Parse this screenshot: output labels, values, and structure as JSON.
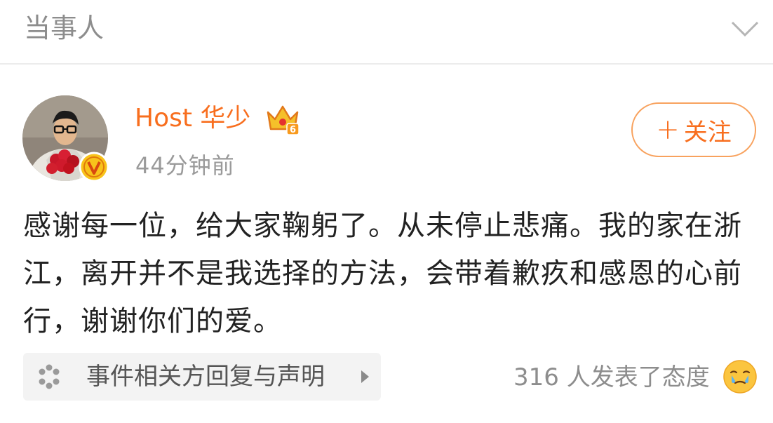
{
  "section": {
    "title": "当事人",
    "collapse_icon": "chevron-down-icon"
  },
  "author": {
    "name": "Host 华少",
    "badge_icon": "crown-level-icon",
    "crown_level": "6",
    "verified_icon": "verified-v-icon",
    "time": "44分钟前"
  },
  "follow": {
    "plus": "+",
    "label": "关注"
  },
  "post": {
    "text": "感谢每一位，给大家鞠躬了。从未停止悲痛。我的家在浙江，离开并不是我选择的方法，会带着歉疚和感恩的心前行，谢谢你们的爱。"
  },
  "topic": {
    "icon": "spinner-icon",
    "label": "事件相关方回复与声明",
    "arrow_icon": "triangle-right-icon"
  },
  "reactions": {
    "text": "316 人发表了态度",
    "emoji": "crying-face-icon"
  },
  "colors": {
    "accent": "#f86e1e",
    "accent_border": "#f8a25e",
    "muted": "#9a9a9a",
    "divider": "#ececec",
    "card_bg": "#f3f3f3"
  }
}
